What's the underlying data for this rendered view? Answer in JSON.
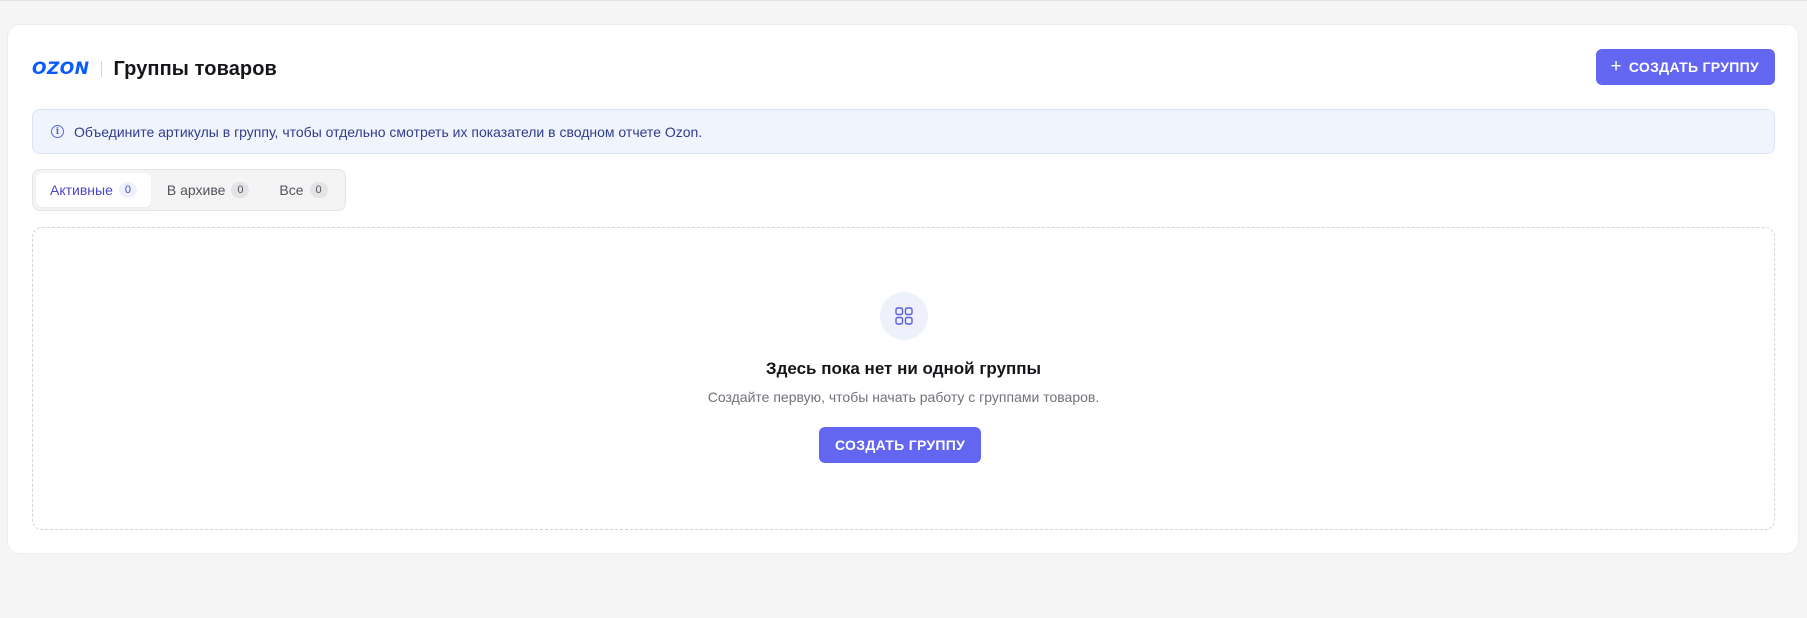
{
  "header": {
    "logo": "OZON",
    "title": "Группы товаров",
    "create_button_label": "СОЗДАТЬ ГРУППУ",
    "create_button_icon": "plus-icon"
  },
  "info_banner": {
    "icon": "info-icon",
    "text": "Объедините артикулы в группу, чтобы отдельно смотреть их показатели в сводном отчете Ozon."
  },
  "tabs": [
    {
      "label": "Активные",
      "count": "0",
      "active": true
    },
    {
      "label": "В архиве",
      "count": "0",
      "active": false
    },
    {
      "label": "Все",
      "count": "0",
      "active": false
    }
  ],
  "empty_state": {
    "icon": "grid-icon",
    "title": "Здесь пока нет ни одной группы",
    "subtitle": "Создайте первую, чтобы начать работу с группами товаров.",
    "button_label": "СОЗДАТЬ ГРУППУ"
  },
  "colors": {
    "accent": "#6366f1",
    "logo": "#0a5bff",
    "info_bg": "#f0f4fd"
  }
}
